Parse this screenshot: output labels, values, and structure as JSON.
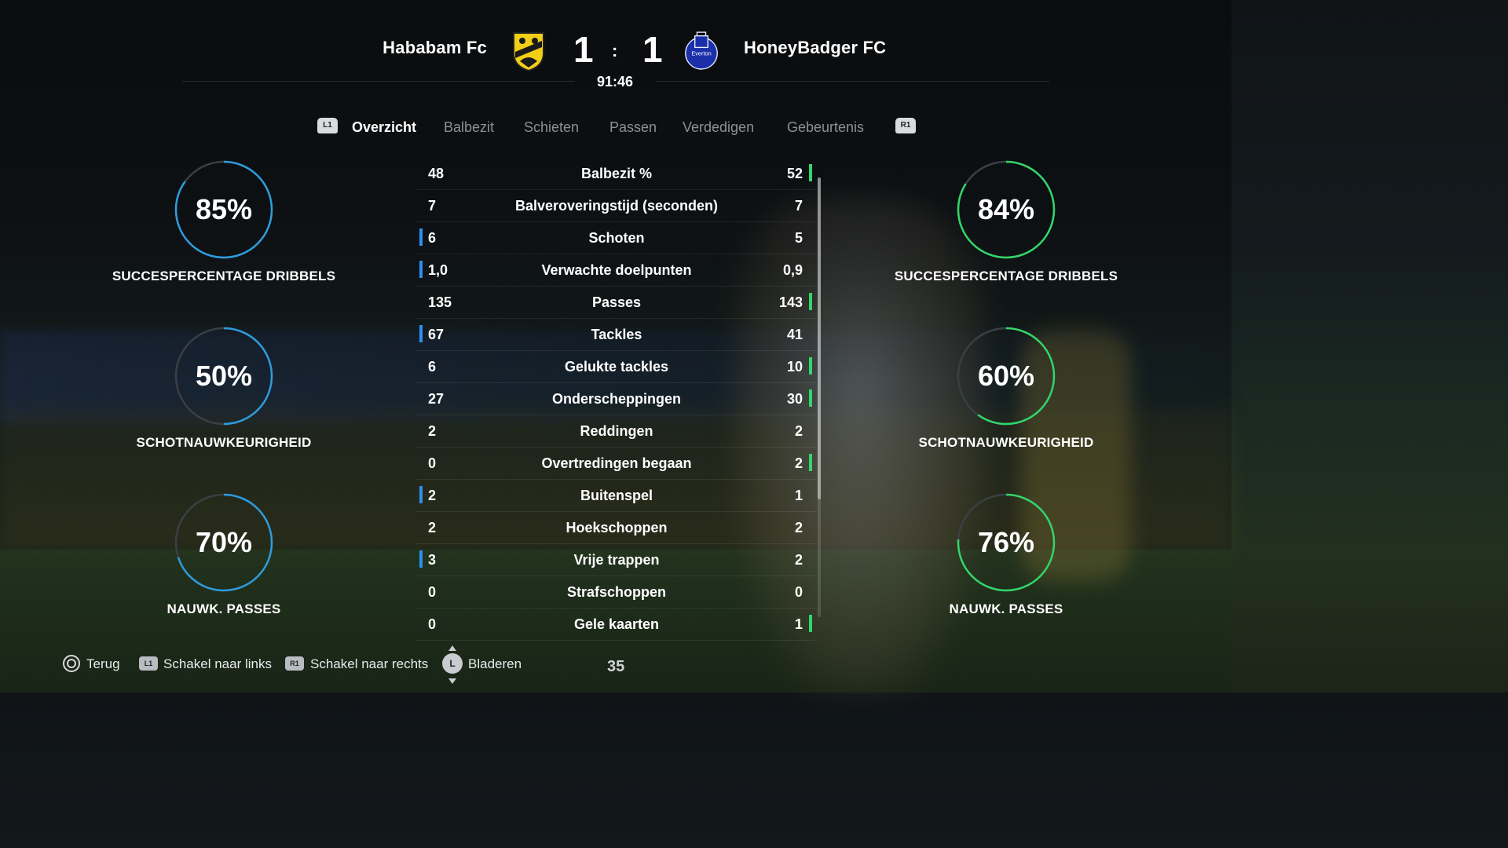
{
  "match": {
    "home_team": "Hababam Fc",
    "away_team": "HoneyBadger FC",
    "home_score": "1",
    "away_score": "1",
    "separator": ":",
    "clock": "91:46",
    "away_crest_text": "Everton"
  },
  "tabs": {
    "left_shoulder": "L1",
    "right_shoulder": "R1",
    "items": [
      "Overzicht",
      "Balbezit",
      "Schieten",
      "Passen",
      "Verdedigen",
      "Gebeurtenis"
    ],
    "active_index": 0
  },
  "rings": {
    "home": [
      {
        "value": "85%",
        "fraction": 0.85,
        "label": "SUCCESPERCENTAGE DRIBBELS"
      },
      {
        "value": "50%",
        "fraction": 0.5,
        "label": "SCHOTNAUWKEURIGHEID"
      },
      {
        "value": "70%",
        "fraction": 0.7,
        "label": "NAUWK. PASSES"
      }
    ],
    "away": [
      {
        "value": "84%",
        "fraction": 0.84,
        "label": "SUCCESPERCENTAGE DRIBBELS"
      },
      {
        "value": "60%",
        "fraction": 0.6,
        "label": "SCHOTNAUWKEURIGHEID"
      },
      {
        "value": "76%",
        "fraction": 0.76,
        "label": "NAUWK. PASSES"
      }
    ],
    "colors": {
      "home": "#2e9bdc",
      "away": "#32d66a",
      "track": "#3a3f44"
    }
  },
  "stats": [
    {
      "label": "Balbezit %",
      "home": "48",
      "away": "52",
      "leader": "away"
    },
    {
      "label": "Balveroveringstijd (seconden)",
      "home": "7",
      "away": "7",
      "leader": "none"
    },
    {
      "label": "Schoten",
      "home": "6",
      "away": "5",
      "leader": "home"
    },
    {
      "label": "Verwachte doelpunten",
      "home": "1,0",
      "away": "0,9",
      "leader": "home"
    },
    {
      "label": "Passes",
      "home": "135",
      "away": "143",
      "leader": "away"
    },
    {
      "label": "Tackles",
      "home": "67",
      "away": "41",
      "leader": "home"
    },
    {
      "label": "Gelukte tackles",
      "home": "6",
      "away": "10",
      "leader": "away"
    },
    {
      "label": "Onderscheppingen",
      "home": "27",
      "away": "30",
      "leader": "away"
    },
    {
      "label": "Reddingen",
      "home": "2",
      "away": "2",
      "leader": "none"
    },
    {
      "label": "Overtredingen begaan",
      "home": "0",
      "away": "2",
      "leader": "away"
    },
    {
      "label": "Buitenspel",
      "home": "2",
      "away": "1",
      "leader": "home"
    },
    {
      "label": "Hoekschoppen",
      "home": "2",
      "away": "2",
      "leader": "none"
    },
    {
      "label": "Vrije trappen",
      "home": "3",
      "away": "2",
      "leader": "home"
    },
    {
      "label": "Strafschoppen",
      "home": "0",
      "away": "0",
      "leader": "none"
    },
    {
      "label": "Gele kaarten",
      "home": "0",
      "away": "1",
      "leader": "away"
    }
  ],
  "footer": {
    "back": "Terug",
    "l1_badge": "L1",
    "r1_badge": "R1",
    "switch_left": "Schakel naar links",
    "switch_right": "Schakel naar rechts",
    "stick_badge": "L",
    "browse": "Bladeren",
    "page": "35"
  }
}
